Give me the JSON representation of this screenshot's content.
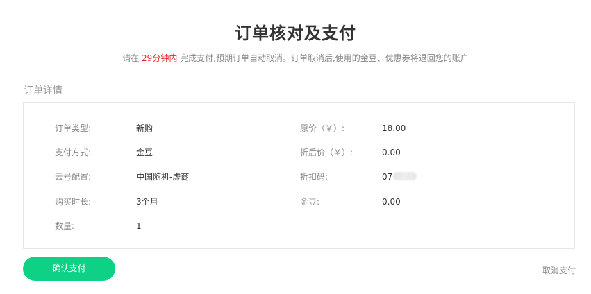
{
  "title": "订单核对及支付",
  "notice": {
    "prefix": "请在",
    "highlight": "29分钟内",
    "suffix": "完成支付,预期订单自动取消。订单取消后,使用的金豆、优惠券将退回您的账户"
  },
  "section_title": "订单详情",
  "details": {
    "order_type": {
      "label": "订单类型:",
      "value": "新购"
    },
    "payment_method": {
      "label": "支付方式:",
      "value": "金豆"
    },
    "cloud_config": {
      "label": "云号配置:",
      "value": "中国随机-虚商"
    },
    "duration": {
      "label": "购买时长:",
      "value": "3个月"
    },
    "quantity": {
      "label": "数量:",
      "value": "1"
    },
    "original_price": {
      "label": "原价（￥）:",
      "value": "18.00"
    },
    "discounted_price": {
      "label": "折后价（￥）:",
      "value": "0.00"
    },
    "discount_code": {
      "label": "折扣码:",
      "value": "07"
    },
    "gold_beans": {
      "label": "金豆:",
      "value": "0.00"
    }
  },
  "actions": {
    "confirm_label": "确认支付",
    "cancel_label": "取消支付"
  },
  "colors": {
    "accent": "#0fd186",
    "highlight": "#e8252a",
    "border": "#e6e6e6"
  }
}
